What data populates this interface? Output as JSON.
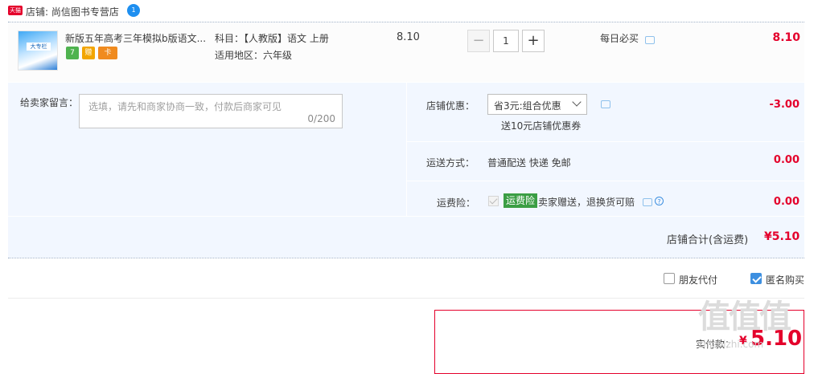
{
  "shop": {
    "badge": "天猫",
    "label": "店铺: 尚信图书专营店",
    "ww_icon": "1"
  },
  "item": {
    "thumbnail_text": "大专栏",
    "title": "新版五年高考三年模拟b版语文...",
    "service_icons": [
      "7",
      "赠",
      "卡"
    ],
    "sku_subject": "科目：【人教版】语文 上册",
    "sku_region": "适用地区：六年级",
    "unit_price": "8.10",
    "quantity": "1",
    "qty_minus": "−",
    "qty_plus": "+",
    "promotion": "每日必买",
    "total": "8.10"
  },
  "options": {
    "memo_label": "给卖家留言：",
    "memo_placeholder": "选填，请先和商家协商一致，付款后商家可见",
    "memo_count": "0/200",
    "coupon_label": "店铺优惠：",
    "coupon_selected": "省3元:组合优惠",
    "coupon_sub": "送10元店铺优惠券",
    "coupon_amount": "-3.00",
    "shipping_label": "运送方式：",
    "shipping_value": "普通配送 快递 免邮",
    "shipping_amount": "0.00",
    "insurance_label": "运费险：",
    "insurance_badge": "运费险",
    "insurance_text": "卖家赠送，退换货可赔",
    "insurance_help": "?",
    "insurance_amount": "0.00",
    "shop_total_label": "店铺合计(含运费)",
    "shop_total_value": "¥5.10"
  },
  "checkout": {
    "friend_pay": "朋友代付",
    "anonymous": "匿名购买",
    "anonymous_checked": true,
    "pay_label": "实付款：",
    "pay_currency": "¥",
    "pay_value": "5.10"
  },
  "watermark": {
    "logo": "值值值",
    "site": "zhizhizhi.com"
  },
  "colors": {
    "accent_red": "#e4002b",
    "option_bg": "#f2f7ff",
    "link_blue": "#3d8fe0",
    "insurance_green": "#3b9e44"
  }
}
